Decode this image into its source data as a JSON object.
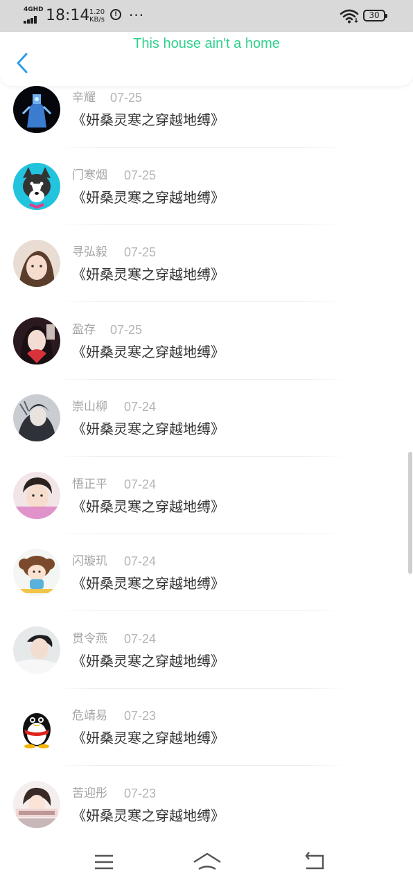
{
  "status_bar": {
    "network": "4GHD",
    "time": "18:14",
    "speed_value": "1.20",
    "speed_unit": "KB/s",
    "circle_icon_text": "Iͅ",
    "more": "···",
    "battery": "30"
  },
  "header": {
    "title": "This house ain't a home",
    "back_icon": "chevron-left-icon",
    "title_color": "#2fd08c",
    "accent_color": "#2d9ee6"
  },
  "comments": [
    {
      "name": "辛耀",
      "date": "07-25",
      "title": "《妍桑灵寒之穿越地缚》",
      "avatar": "avatar-1"
    },
    {
      "name": "门寒烟",
      "date": "07-25",
      "title": "《妍桑灵寒之穿越地缚》",
      "avatar": "avatar-2"
    },
    {
      "name": "寻弘毅",
      "date": "07-25",
      "title": "《妍桑灵寒之穿越地缚》",
      "avatar": "avatar-3"
    },
    {
      "name": "盈存",
      "date": "07-25",
      "title": "《妍桑灵寒之穿越地缚》",
      "avatar": "avatar-4"
    },
    {
      "name": "崇山柳",
      "date": "07-24",
      "title": "《妍桑灵寒之穿越地缚》",
      "avatar": "avatar-5"
    },
    {
      "name": "悟正平",
      "date": "07-24",
      "title": "《妍桑灵寒之穿越地缚》",
      "avatar": "avatar-6"
    },
    {
      "name": "闪璇玑",
      "date": "07-24",
      "title": "《妍桑灵寒之穿越地缚》",
      "avatar": "avatar-7"
    },
    {
      "name": "贯令燕",
      "date": "07-24",
      "title": "《妍桑灵寒之穿越地缚》",
      "avatar": "avatar-8"
    },
    {
      "name": "危靖易",
      "date": "07-23",
      "title": "《妍桑灵寒之穿越地缚》",
      "avatar": "penguin-avatar"
    },
    {
      "name": "苦迎彤",
      "date": "07-23",
      "title": "《妍桑灵寒之穿越地缚》",
      "avatar": "avatar-10"
    }
  ],
  "nav": {
    "menu_icon": "menu-icon",
    "home_icon": "home-icon",
    "back_icon": "back-icon"
  }
}
